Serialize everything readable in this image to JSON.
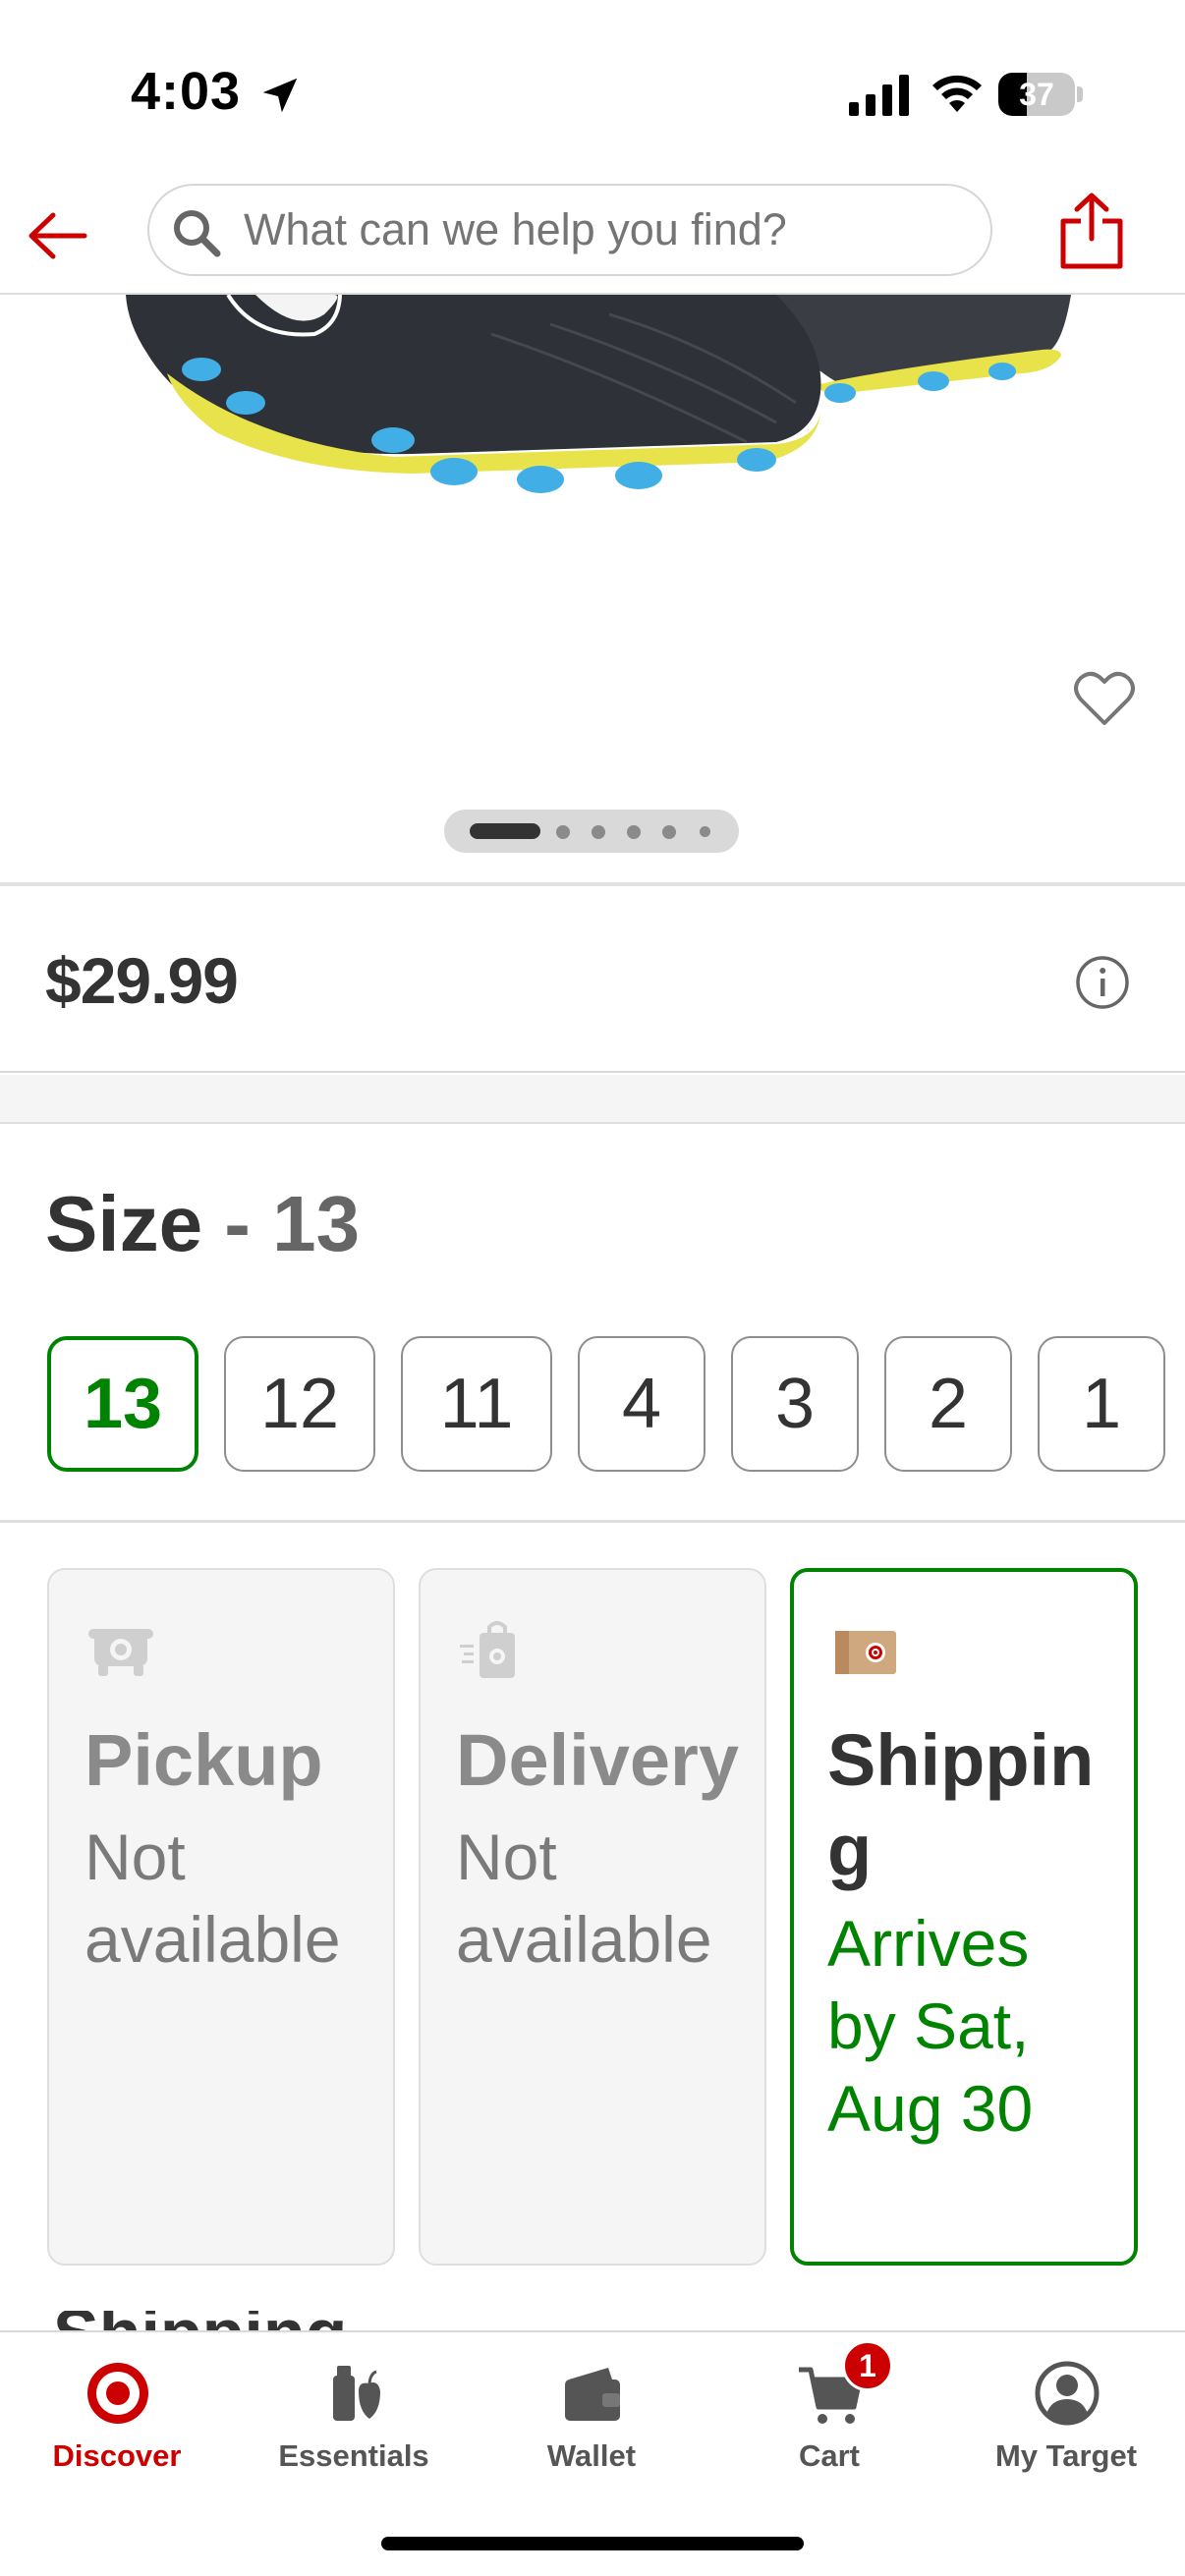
{
  "status_bar": {
    "time": "4:03",
    "battery": "37",
    "battery_level": 0.37
  },
  "search": {
    "placeholder": "What can we help you find?"
  },
  "product": {
    "price": "$29.99",
    "carousel": {
      "total": 6,
      "active_index": 0
    }
  },
  "size": {
    "label": "Size",
    "separator": " - ",
    "selected": "13",
    "options": [
      "13",
      "12",
      "11",
      "4",
      "3",
      "2",
      "1"
    ]
  },
  "fulfillment": {
    "pickup": {
      "title": "Pickup",
      "status": "Not available"
    },
    "delivery": {
      "title": "Delivery",
      "status": "Not available"
    },
    "shipping": {
      "title": "Shipping",
      "status": "Arrives by Sat, Aug 30"
    }
  },
  "obscured_heading": "Shipping",
  "bottom_nav": {
    "items": [
      {
        "label": "Discover",
        "icon": "target-bullseye-icon",
        "active": true
      },
      {
        "label": "Essentials",
        "icon": "essentials-icon"
      },
      {
        "label": "Wallet",
        "icon": "wallet-icon"
      },
      {
        "label": "Cart",
        "icon": "cart-icon",
        "badge": "1"
      },
      {
        "label": "My Target",
        "icon": "account-icon"
      }
    ]
  },
  "colors": {
    "brand_red": "#cc0000",
    "selected_green": "#008300",
    "text_dark": "#333333"
  }
}
